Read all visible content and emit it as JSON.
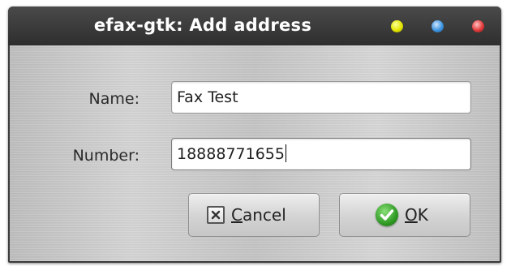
{
  "window": {
    "title": "efax-gtk: Add address",
    "controls": [
      "minimize-icon",
      "maximize-icon",
      "close-icon"
    ],
    "colors": {
      "titlebar": "#3b3b3b",
      "minimize": "#e4e400",
      "maximize": "#3e94e0",
      "close": "#e23b3b"
    }
  },
  "form": {
    "name_label": "Name:",
    "name_value": "Fax Test",
    "number_label": "Number:",
    "number_value": "18888771655"
  },
  "buttons": {
    "cancel_label": "Cancel",
    "cancel_icon": "cancel-x-icon",
    "ok_label": "OK",
    "ok_icon": "checkmark-icon",
    "ok_icon_color": "#2f9a24"
  }
}
